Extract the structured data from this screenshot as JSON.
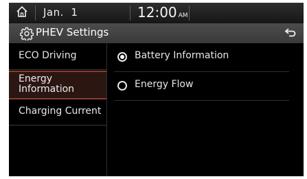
{
  "status": {
    "date": "Jan.  1",
    "time": "12:00",
    "ampm": "AM"
  },
  "header": {
    "title": "PHEV Settings"
  },
  "icons": {
    "home": "home-icon",
    "settings": "gear-icon",
    "back": "back-arrow-icon"
  },
  "sidebar": {
    "items": [
      {
        "label": "ECO Driving",
        "selected": false
      },
      {
        "label_line1": "Energy",
        "label_line2": "Information",
        "selected": true
      },
      {
        "label": "Charging Current",
        "selected": false
      }
    ]
  },
  "options": [
    {
      "label": "Battery Information",
      "checked": true
    },
    {
      "label": "Energy Flow",
      "checked": false
    }
  ],
  "colors": {
    "background": "#000000",
    "selection_accent": "#8a3b30"
  }
}
